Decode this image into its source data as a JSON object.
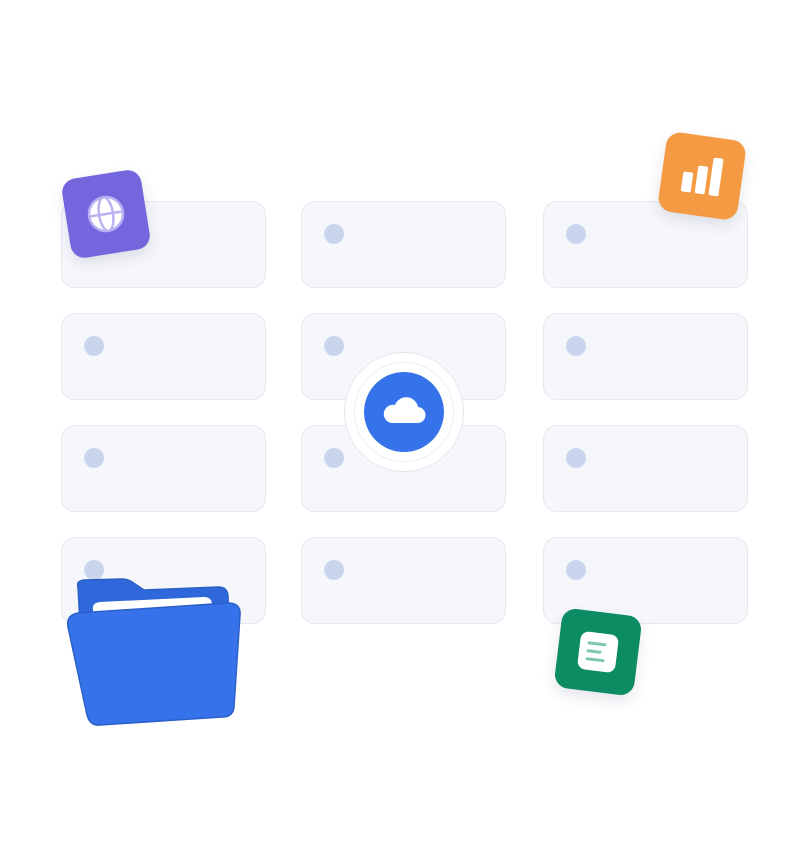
{
  "colors": {
    "background": "#ffffff",
    "card_background": "#f6f7fb",
    "card_border": "#e6e8f0",
    "placeholder_dot": "#c8d5ec",
    "globe_tile": "#7467dd",
    "chart_tile": "#f39a43",
    "doc_tile": "#0b8c63",
    "cloud_primary": "#3673ea",
    "folder": "#3673ea"
  },
  "icons": {
    "globe": "globe-icon",
    "chart": "bar-chart-icon",
    "document": "document-icon",
    "cloud": "cloud-icon",
    "folder": "folder-icon"
  },
  "grid": {
    "columns": 3,
    "rows": 4,
    "card_count": 12
  }
}
